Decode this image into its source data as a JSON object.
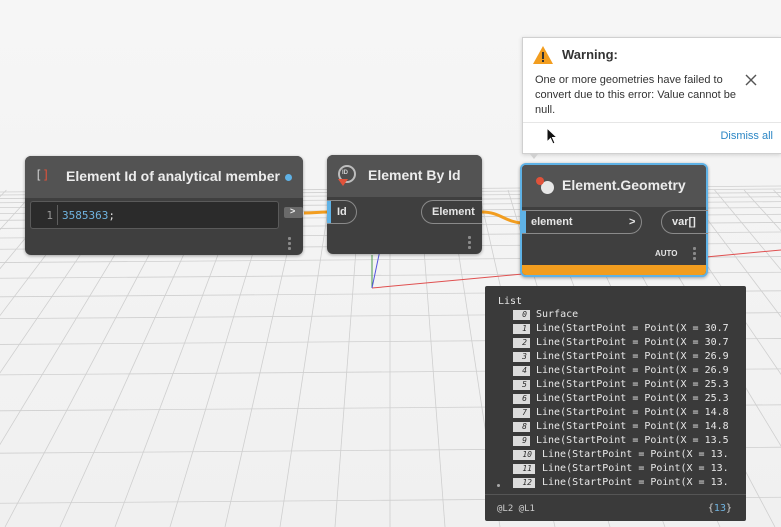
{
  "nodes": {
    "code_block": {
      "title": "Element Id of analytical member",
      "icon": "code-block-icon",
      "line_number": "1",
      "code_value": "3585363",
      "code_suffix": ";",
      "output_port_label": ">"
    },
    "element_by_id": {
      "title": "Element By Id",
      "icon": "element-id-icon",
      "input_port": "Id",
      "output_port": "Element"
    },
    "element_geometry": {
      "title": "Element.Geometry",
      "icon": "geometry-icon",
      "input_port": "element",
      "input_chevron": ">",
      "output_port": "var[]",
      "lacing": "AUTO",
      "state_color": "#f29d1f"
    }
  },
  "warning": {
    "title": "Warning:",
    "message": "One or more geometries have failed to convert due to this error: Value cannot be null.",
    "dismiss_label": "Dismiss all",
    "icon": "warning-icon"
  },
  "preview": {
    "header": "List",
    "items": [
      {
        "index": "0",
        "value": "Surface"
      },
      {
        "index": "1",
        "value": "Line(StartPoint = Point(X = 30.7"
      },
      {
        "index": "2",
        "value": "Line(StartPoint = Point(X = 30.7"
      },
      {
        "index": "3",
        "value": "Line(StartPoint = Point(X = 26.9"
      },
      {
        "index": "4",
        "value": "Line(StartPoint = Point(X = 26.9"
      },
      {
        "index": "5",
        "value": "Line(StartPoint = Point(X = 25.3"
      },
      {
        "index": "6",
        "value": "Line(StartPoint = Point(X = 25.3"
      },
      {
        "index": "7",
        "value": "Line(StartPoint = Point(X = 14.8"
      },
      {
        "index": "8",
        "value": "Line(StartPoint = Point(X = 14.8"
      },
      {
        "index": "9",
        "value": "Line(StartPoint = Point(X = 13.5"
      },
      {
        "index": "10",
        "value": "Line(StartPoint = Point(X = 13."
      },
      {
        "index": "11",
        "value": "Line(StartPoint = Point(X = 13."
      },
      {
        "index": "12",
        "value": "Line(StartPoint = Point(X = 13."
      }
    ],
    "levels": "@L2 @L1",
    "count": "13"
  },
  "colors": {
    "accent": "#2b86c5",
    "wire": "#f29d1f",
    "node_body": "#3f3f3f",
    "node_header": "#535353",
    "selection": "#5fb2e6"
  }
}
